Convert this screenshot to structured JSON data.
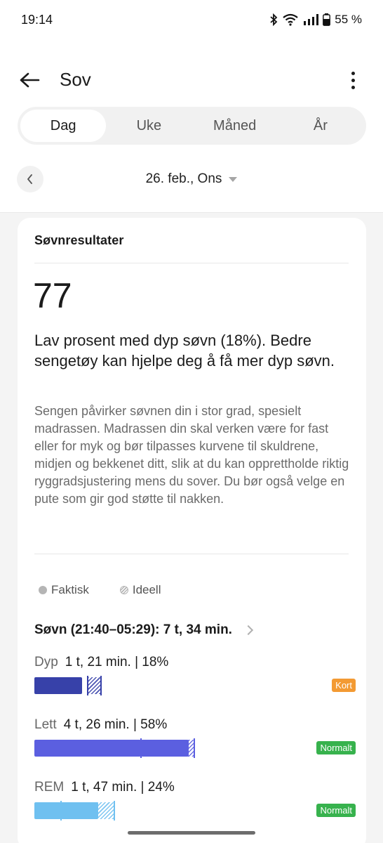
{
  "status": {
    "time": "19:14",
    "battery": "55 %"
  },
  "app_bar": {
    "title": "Sov"
  },
  "tabs": [
    {
      "label": "Dag",
      "active": true
    },
    {
      "label": "Uke",
      "active": false
    },
    {
      "label": "Måned",
      "active": false
    },
    {
      "label": "År",
      "active": false
    }
  ],
  "date": {
    "label": "26. feb., Ons"
  },
  "card": {
    "title": "Søvnresultater",
    "score": "77",
    "headline": "Lav prosent med dyp søvn (18%). Bedre sengetøy kan hjelpe deg å få mer dyp søvn.",
    "body": "Sengen påvirker søvnen din i stor grad, spesielt madrassen. Madrassen din skal verken være for fast eller for myk og bør tilpasses kurvene til skuldrene, midjen og bekkenet ditt, slik at du kan opprettholde riktig ryggradsjustering mens du sover. Du bør også velge en pute som gir god støtte til nakken."
  },
  "legend": {
    "actual": "Faktisk",
    "ideal": "Ideell"
  },
  "sleep": {
    "summary": "Søvn (21:40–05:29): 7 t, 34 min.",
    "stages": [
      {
        "name": "Dyp",
        "detail": "1 t, 21 min. | 18%",
        "percent": 18,
        "badge": "Kort",
        "badge_color": "#f39a33",
        "bar_color": "#3741a9",
        "ideal_range": [
          20,
          25
        ]
      },
      {
        "name": "Lett",
        "detail": "4 t, 26 min. | 58%",
        "percent": 58,
        "badge": "Normalt",
        "badge_color": "#37b24d",
        "bar_color": "#5b5fe0",
        "ideal_range": [
          40,
          60
        ]
      },
      {
        "name": "REM",
        "detail": "1 t, 47 min. | 24%",
        "percent": 24,
        "badge": "Normalt",
        "badge_color": "#37b24d",
        "bar_color": "#6fc0f0",
        "ideal_range": [
          10,
          30
        ]
      }
    ]
  }
}
